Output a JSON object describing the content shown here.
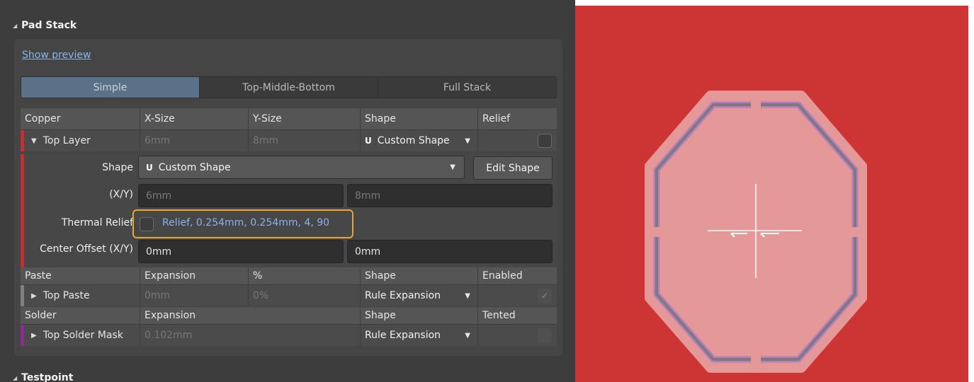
{
  "panel": {
    "pad_stack_title": "Pad Stack",
    "show_preview": "Show preview",
    "tabs": [
      "Simple",
      "Top-Middle-Bottom",
      "Full Stack"
    ],
    "active_tab": "Simple",
    "copper": {
      "headers": [
        "Copper",
        "X-Size",
        "Y-Size",
        "Shape",
        "Relief"
      ],
      "row": {
        "name": "Top Layer",
        "x_size": "6mm",
        "y_size": "8mm",
        "shape": "Custom Shape",
        "relief_checked": false,
        "layer_color": "#c43030"
      }
    },
    "details": {
      "shape_label": "Shape",
      "shape_value": "Custom Shape",
      "edit_shape": "Edit Shape",
      "xy_label": "(X/Y)",
      "x_value": "6mm",
      "y_value": "8mm",
      "thermal_label": "Thermal Relief",
      "thermal_value": "Relief, 0.254mm, 0.254mm, 4, 90",
      "offset_label": "Center Offset (X/Y)",
      "offset_x": "0mm",
      "offset_y": "0mm"
    },
    "paste": {
      "headers": [
        "Paste",
        "Expansion",
        "%",
        "Shape",
        "Enabled"
      ],
      "row": {
        "name": "Top Paste",
        "expansion": "0mm",
        "percent": "0%",
        "shape": "Rule Expansion",
        "enabled": true,
        "layer_color": "#808080"
      }
    },
    "solder": {
      "headers": [
        "Solder",
        "Expansion",
        "Shape",
        "Tented"
      ],
      "row": {
        "name": "Top Solder Mask",
        "expansion": "0.102mm",
        "shape": "Rule Expansion",
        "tented": false,
        "layer_color": "#8a2f8c"
      }
    },
    "testpoint_title": "Testpoint"
  },
  "preview": {
    "background": "#cd3535",
    "pad_fill": "#e49898",
    "outline_gray": "#7b7b7b",
    "outline_purple": "#b87dc0",
    "crosshair": "#ffffff"
  }
}
